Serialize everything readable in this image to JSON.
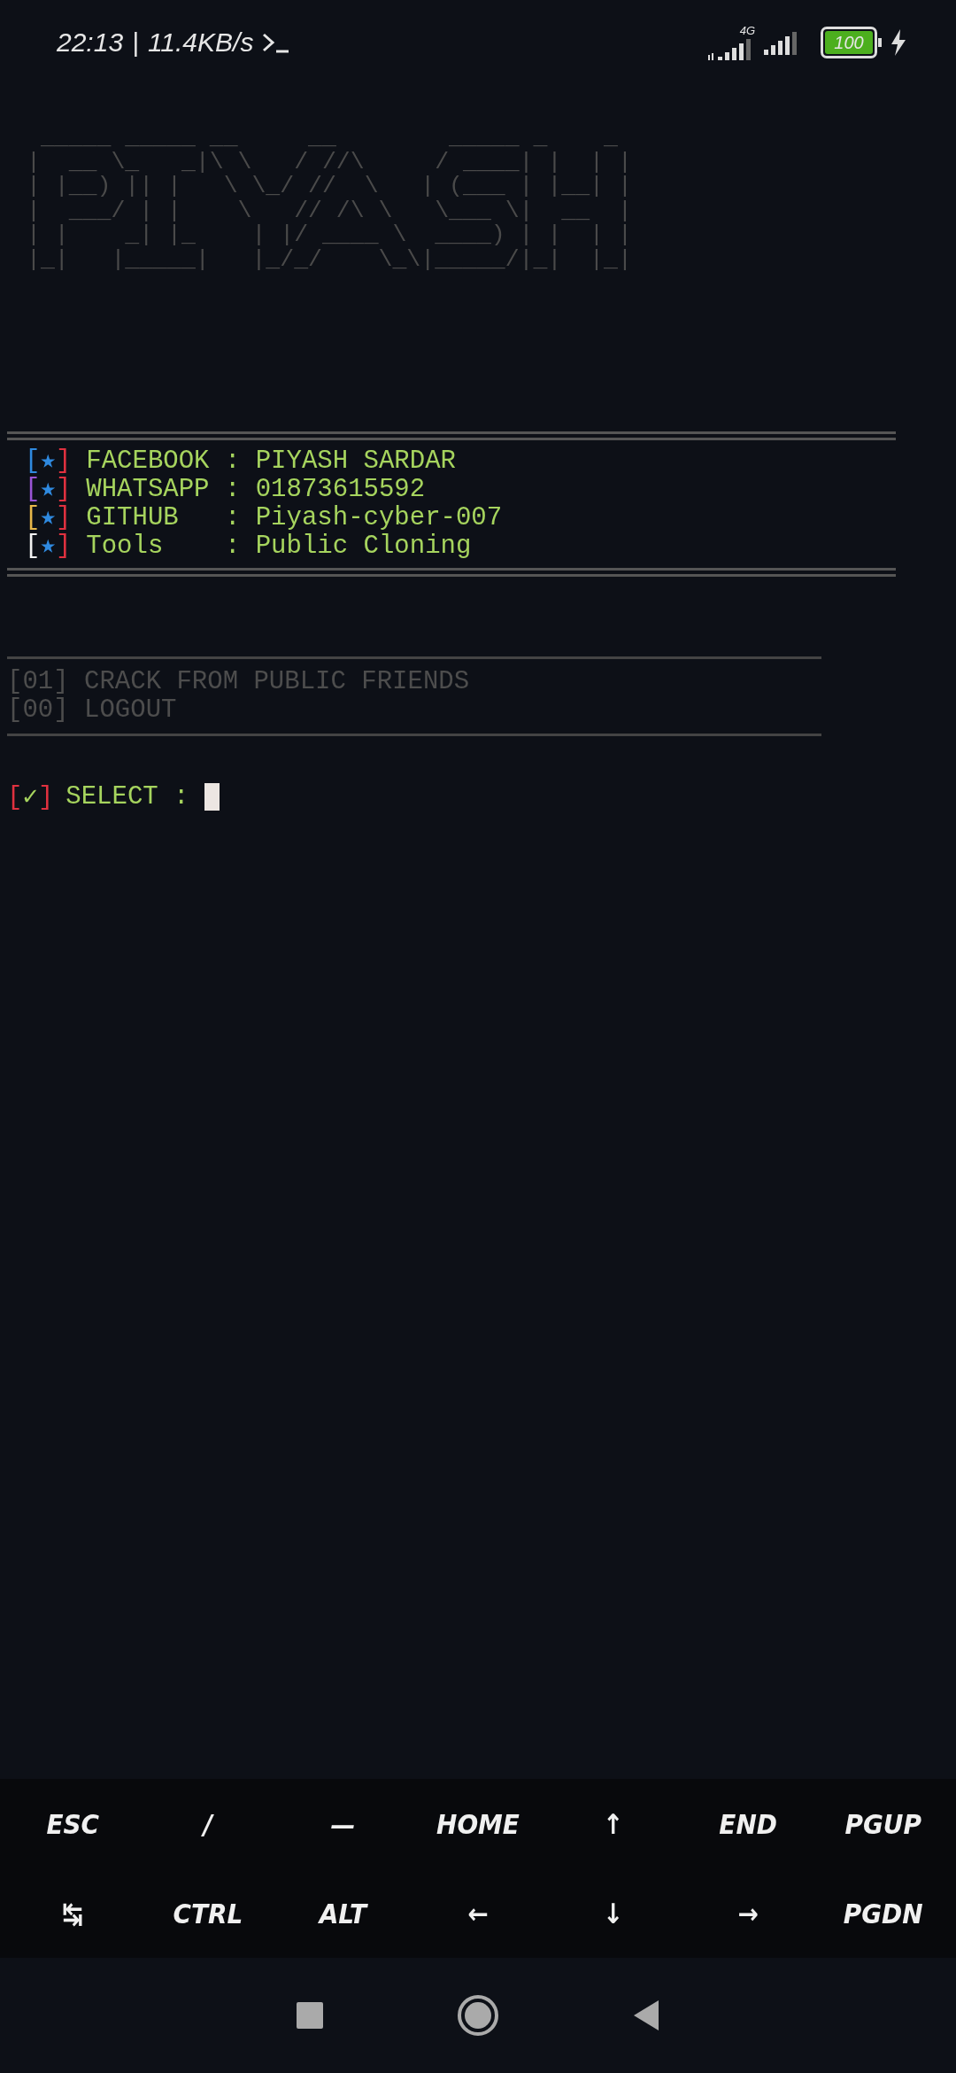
{
  "status_bar": {
    "time": "22:13",
    "separator": "|",
    "speed": "11.4KB/s",
    "network": "4G",
    "battery": "100"
  },
  "banner": [
    " _____ _____ __     __        _____ _    _ ",
    "|  __ \\_   _|\\ \\   / //\\     / ____| |  | |",
    "| |__) || |   \\ \\_/ //  \\   | (___ | |__| |",
    "|  ___/ | |    \\   // /\\ \\   \\___ \\|  __  |",
    "| |    _| |_    | |/ ____ \\  ____) | |  | |",
    "|_|   |_____|   |_/_/    \\_\\|_____/|_|  |_|"
  ],
  "info": [
    {
      "open": "[",
      "mark": "★",
      "close": "]",
      "color": "#2f8ae0",
      "text": "FACEBOOK : PIYASH SARDAR"
    },
    {
      "open": "[",
      "mark": "★",
      "close": "]",
      "color": "#9b55d6",
      "text": "WHATSAPP : 01873615592"
    },
    {
      "open": "[",
      "mark": "★",
      "close": "]",
      "color": "#e8b84a",
      "text": "GITHUB   : Piyash-cyber-007"
    },
    {
      "open": "[",
      "mark": "★",
      "close": "]",
      "color": "#f2f2f2",
      "text": "Tools    : Public Cloning"
    }
  ],
  "menu": [
    "[01] CRACK FROM PUBLIC FRIENDS",
    "[00] LOGOUT"
  ],
  "prompt": {
    "open": "[",
    "mark": "✓",
    "close": "]",
    "label": "SELECT :"
  },
  "keys": [
    [
      "ESC",
      "/",
      "—",
      "HOME",
      "↑",
      "END",
      "PGUP"
    ],
    [
      "↹",
      "CTRL",
      "ALT",
      "←",
      "↓",
      "→",
      "PGDN"
    ]
  ]
}
